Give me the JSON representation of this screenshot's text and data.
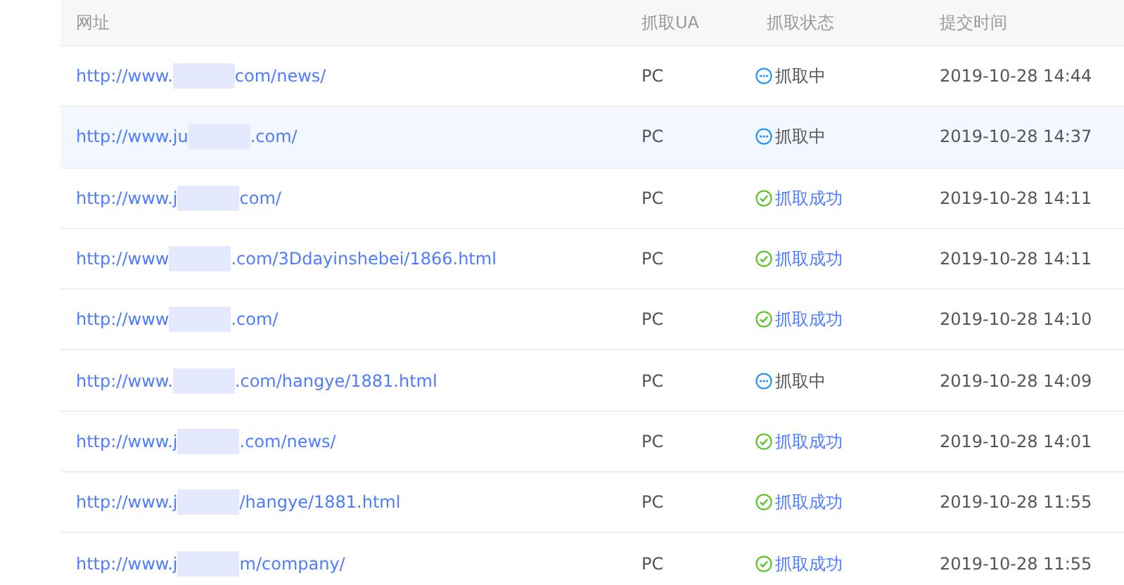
{
  "table": {
    "columns": [
      "网址",
      "抓取UA",
      "抓取状态",
      "提交时间"
    ],
    "rows": [
      {
        "url_head": "http://www.",
        "url_tail": "com/news/",
        "ua": "PC",
        "status": {
          "kind": "crawling",
          "label": "抓取中"
        },
        "time": "2019-10-28 14:44",
        "selected": false
      },
      {
        "url_head": "http://www.ju",
        "url_tail": ".com/",
        "ua": "PC",
        "status": {
          "kind": "crawling",
          "label": "抓取中"
        },
        "time": "2019-10-28 14:37",
        "selected": true
      },
      {
        "url_head": "http://www.j",
        "url_tail": "com/",
        "ua": "PC",
        "status": {
          "kind": "success",
          "label": "抓取成功"
        },
        "time": "2019-10-28 14:11",
        "selected": false
      },
      {
        "url_head": "http://www",
        "url_tail": ".com/3Ddayinshebei/1866.html",
        "ua": "PC",
        "status": {
          "kind": "success",
          "label": "抓取成功"
        },
        "time": "2019-10-28 14:11",
        "selected": false
      },
      {
        "url_head": "http://www",
        "url_tail": ".com/",
        "ua": "PC",
        "status": {
          "kind": "success",
          "label": "抓取成功"
        },
        "time": "2019-10-28 14:10",
        "selected": false
      },
      {
        "url_head": "http://www.",
        "url_tail": ".com/hangye/1881.html",
        "ua": "PC",
        "status": {
          "kind": "crawling",
          "label": "抓取中"
        },
        "time": "2019-10-28 14:09",
        "selected": false
      },
      {
        "url_head": "http://www.j",
        "url_tail": ".com/news/",
        "ua": "PC",
        "status": {
          "kind": "success",
          "label": "抓取成功"
        },
        "time": "2019-10-28 14:01",
        "selected": false
      },
      {
        "url_head": "http://www.j",
        "url_tail": "/hangye/1881.html",
        "ua": "PC",
        "status": {
          "kind": "success",
          "label": "抓取成功"
        },
        "time": "2019-10-28 11:55",
        "selected": false
      },
      {
        "url_head": "http://www.j",
        "url_tail": "m/company/",
        "ua": "PC",
        "status": {
          "kind": "success",
          "label": "抓取成功"
        },
        "time": "2019-10-28 11:55",
        "selected": false
      }
    ]
  }
}
